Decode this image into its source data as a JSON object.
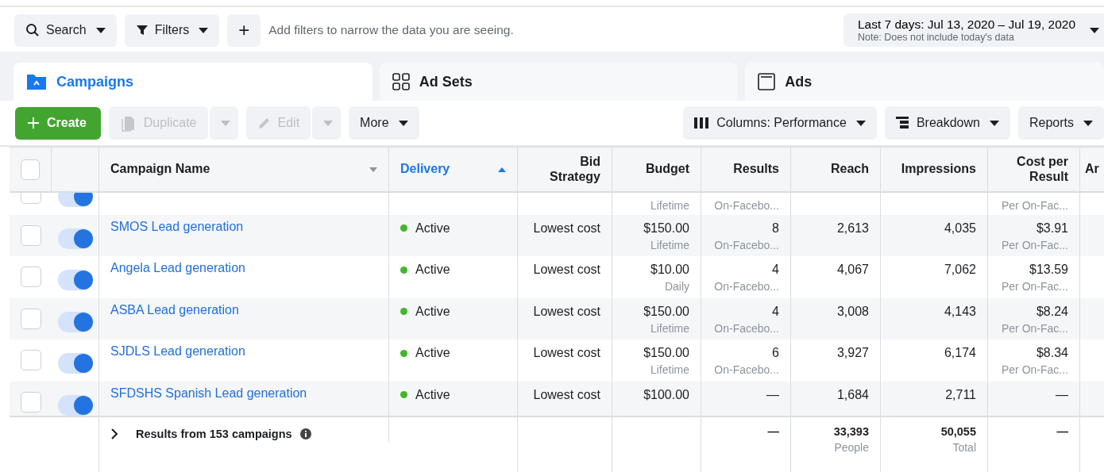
{
  "filter_bar": {
    "search": "Search",
    "filters": "Filters",
    "add": "+",
    "placeholder": "Add filters to narrow the data you are seeing.",
    "date_range": "Last 7 days: Jul 13, 2020 – Jul 19, 2020",
    "date_note": "Note: Does not include today's data"
  },
  "tabs": [
    {
      "label": "Campaigns",
      "selected": true,
      "kind": "folder"
    },
    {
      "label": "Ad Sets",
      "selected": false,
      "kind": "grid"
    },
    {
      "label": "Ads",
      "selected": false,
      "kind": "window"
    }
  ],
  "toolbar": {
    "left": [
      {
        "label": "Create",
        "kind": "create",
        "disabled": false
      },
      {
        "label": "Duplicate",
        "kind": "duplicate",
        "disabled": true
      },
      {
        "label": "Edit",
        "kind": "edit",
        "disabled": true
      },
      {
        "label": "More",
        "kind": "more",
        "disabled": false
      }
    ],
    "right": [
      {
        "label": "Columns: Performance",
        "kind": "columns"
      },
      {
        "label": "Breakdown",
        "kind": "breakdown"
      },
      {
        "label": "Reports",
        "kind": "reports"
      }
    ]
  },
  "table": {
    "select_all_checked": false,
    "columns": [
      {
        "label": "Campaign Name",
        "kind": "name",
        "sorted": false
      },
      {
        "label": "Delivery",
        "kind": "status",
        "sorted": true
      },
      {
        "label": "Bid Strategy",
        "kind": "value"
      },
      {
        "label": "Budget",
        "kind": "value"
      },
      {
        "label": "Results",
        "kind": "value"
      },
      {
        "label": "Reach",
        "kind": "value"
      },
      {
        "label": "Impressions",
        "kind": "value"
      },
      {
        "label": "Cost per Result",
        "kind": "value"
      },
      {
        "label": "Ar",
        "kind": "cut"
      }
    ],
    "rows": [
      {
        "kind": "partial",
        "checked": false,
        "on": true,
        "cells": [
          {},
          {},
          {},
          {
            "sub": "Lifetime"
          },
          {
            "sub": "On-Facebo..."
          },
          {},
          {},
          {
            "sub": "Per On-Fac..."
          }
        ]
      },
      {
        "kind": "full",
        "checked": false,
        "on": true,
        "cells": [
          {
            "main": "SMOS Lead generation"
          },
          {
            "main": "Active"
          },
          {
            "main": "Lowest cost"
          },
          {
            "main": "$150.00",
            "sub": "Lifetime"
          },
          {
            "main": "8",
            "sub": "On-Facebo..."
          },
          {
            "main": "2,613"
          },
          {
            "main": "4,035"
          },
          {
            "main": "$3.91",
            "sub": "Per On-Fac..."
          }
        ]
      },
      {
        "kind": "full",
        "checked": false,
        "on": true,
        "cells": [
          {
            "main": "Angela Lead generation"
          },
          {
            "main": "Active"
          },
          {
            "main": "Lowest cost"
          },
          {
            "main": "$10.00",
            "sub": "Daily"
          },
          {
            "main": "4",
            "sub": "On-Facebo..."
          },
          {
            "main": "4,067"
          },
          {
            "main": "7,062"
          },
          {
            "main": "$13.59",
            "sub": "Per On-Fac..."
          }
        ]
      },
      {
        "kind": "full",
        "checked": false,
        "on": true,
        "cells": [
          {
            "main": "ASBA Lead generation"
          },
          {
            "main": "Active"
          },
          {
            "main": "Lowest cost"
          },
          {
            "main": "$150.00",
            "sub": "Lifetime"
          },
          {
            "main": "4",
            "sub": "On-Facebo..."
          },
          {
            "main": "3,008"
          },
          {
            "main": "4,143"
          },
          {
            "main": "$8.24",
            "sub": "Per On-Fac..."
          }
        ]
      },
      {
        "kind": "full",
        "checked": false,
        "on": true,
        "cells": [
          {
            "main": "SJDLS Lead generation"
          },
          {
            "main": "Active"
          },
          {
            "main": "Lowest cost"
          },
          {
            "main": "$150.00",
            "sub": "Lifetime"
          },
          {
            "main": "6",
            "sub": "On-Facebo..."
          },
          {
            "main": "3,927"
          },
          {
            "main": "6,174"
          },
          {
            "main": "$8.34",
            "sub": "Per On-Fac..."
          }
        ]
      },
      {
        "kind": "full",
        "checked": false,
        "on": true,
        "cells": [
          {
            "main": "SFDSHS Spanish Lead generation"
          },
          {
            "main": "Active"
          },
          {
            "main": "Lowest cost"
          },
          {
            "main": "$100.00"
          },
          {
            "main": "—"
          },
          {
            "main": "1,684"
          },
          {
            "main": "2,711"
          },
          {
            "main": "—"
          }
        ]
      }
    ],
    "summary": {
      "label": "Results from 153 campaigns",
      "cells": [
        {},
        {},
        {
          "main": "—"
        },
        {
          "main": "33,393",
          "sub": "People"
        },
        {
          "main": "50,055",
          "sub": "Total"
        },
        {
          "main": "—"
        }
      ]
    }
  }
}
